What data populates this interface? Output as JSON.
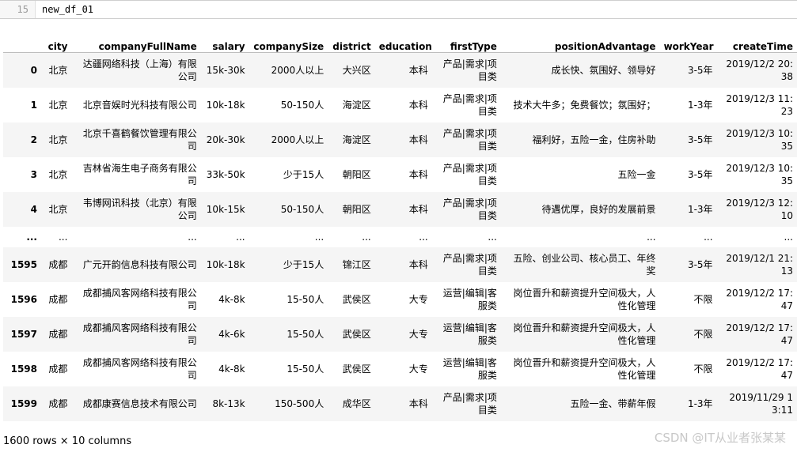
{
  "cell": {
    "prompt": "15",
    "code": "new_df_01"
  },
  "table": {
    "columns": [
      "",
      "city",
      "companyFullName",
      "salary",
      "companySize",
      "district",
      "education",
      "firstType",
      "positionAdvantage",
      "workYear",
      "createTime"
    ],
    "rows": [
      [
        "0",
        "北京",
        "达疆网络科技（上海）有限公司",
        "15k-30k",
        "2000人以上",
        "大兴区",
        "本科",
        "产品|需求|项目类",
        "成长快、氛围好、领导好",
        "3-5年",
        "2019/12/2 20:38"
      ],
      [
        "1",
        "北京",
        "北京音娱时光科技有限公司",
        "10k-18k",
        "50-150人",
        "海淀区",
        "本科",
        "产品|需求|项目类",
        "技术大牛多；免费餐饮；氛围好；",
        "1-3年",
        "2019/12/3 11:23"
      ],
      [
        "2",
        "北京",
        "北京千喜鹤餐饮管理有限公司",
        "20k-30k",
        "2000人以上",
        "海淀区",
        "本科",
        "产品|需求|项目类",
        "福利好，五险一金，住房补助",
        "3-5年",
        "2019/12/3 10:35"
      ],
      [
        "3",
        "北京",
        "吉林省海生电子商务有限公司",
        "33k-50k",
        "少于15人",
        "朝阳区",
        "本科",
        "产品|需求|项目类",
        "五险一金",
        "3-5年",
        "2019/12/3 10:35"
      ],
      [
        "4",
        "北京",
        "韦博网讯科技（北京）有限公司",
        "10k-15k",
        "50-150人",
        "朝阳区",
        "本科",
        "产品|需求|项目类",
        "待遇优厚，良好的发展前景",
        "1-3年",
        "2019/12/3 12:10"
      ],
      [
        "...",
        "...",
        "...",
        "...",
        "...",
        "...",
        "...",
        "...",
        "...",
        "...",
        "..."
      ],
      [
        "1595",
        "成都",
        "广元开韵信息科技有限公司",
        "10k-18k",
        "少于15人",
        "锦江区",
        "本科",
        "产品|需求|项目类",
        "五险、创业公司、核心员工、年终奖",
        "3-5年",
        "2019/12/1 21:13"
      ],
      [
        "1596",
        "成都",
        "成都捕风客网络科技有限公司",
        "4k-8k",
        "15-50人",
        "武侯区",
        "大专",
        "运营|编辑|客服类",
        "岗位晋升和薪资提升空间极大，人性化管理",
        "不限",
        "2019/12/2 17:47"
      ],
      [
        "1597",
        "成都",
        "成都捕风客网络科技有限公司",
        "4k-6k",
        "15-50人",
        "武侯区",
        "大专",
        "运营|编辑|客服类",
        "岗位晋升和薪资提升空间极大，人性化管理",
        "不限",
        "2019/12/2 17:47"
      ],
      [
        "1598",
        "成都",
        "成都捕风客网络科技有限公司",
        "4k-8k",
        "15-50人",
        "武侯区",
        "大专",
        "运营|编辑|客服类",
        "岗位晋升和薪资提升空间极大，人性化管理",
        "不限",
        "2019/12/2 17:47"
      ],
      [
        "1599",
        "成都",
        "成都康赛信息技术有限公司",
        "8k-13k",
        "150-500人",
        "成华区",
        "本科",
        "产品|需求|项目类",
        "五险一金、带薪年假",
        "1-3年",
        "2019/11/29 13:11"
      ]
    ]
  },
  "footer": "1600 rows × 10 columns",
  "watermark": "CSDN @IT从业者张某某"
}
